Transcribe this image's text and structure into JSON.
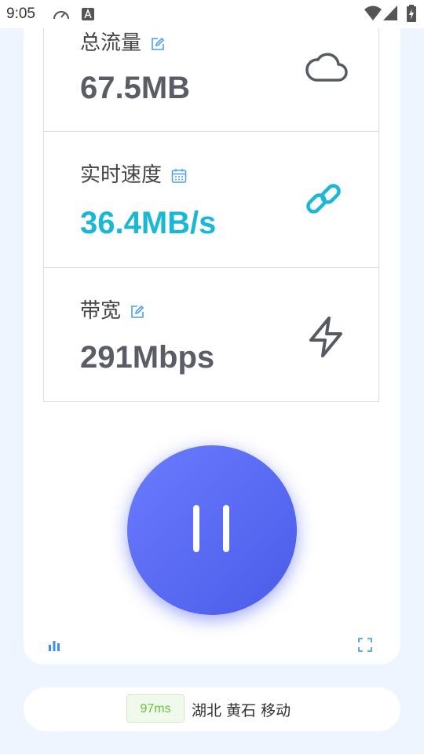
{
  "status_bar": {
    "time": "9:05",
    "icons": [
      "speedometer-icon",
      "font-a-icon",
      "wifi-icon",
      "signal-icon",
      "battery-icon"
    ]
  },
  "stats": [
    {
      "label": "总流量",
      "value": "67.5MB",
      "label_icon": "edit-icon",
      "icon": "cloud-icon"
    },
    {
      "label": "实时速度",
      "value": "36.4MB/s",
      "label_icon": "calendar-icon",
      "icon": "link-icon"
    },
    {
      "label": "带宽",
      "value": "291Mbps",
      "label_icon": "edit-icon",
      "icon": "lightning-icon"
    }
  ],
  "colors": {
    "accent_blue": "#5566f0",
    "speed_cyan": "#1ab8d6",
    "label_icon_blue": "#4a9ff5",
    "latency_green": "#67c23a"
  },
  "controls": {
    "pause_icon": "pause-icon",
    "bottom_left_icon": "bar-chart-icon",
    "bottom_right_icon": "fullscreen-icon"
  },
  "server": {
    "latency": "97ms",
    "location": "湖北 黄石 移动"
  }
}
